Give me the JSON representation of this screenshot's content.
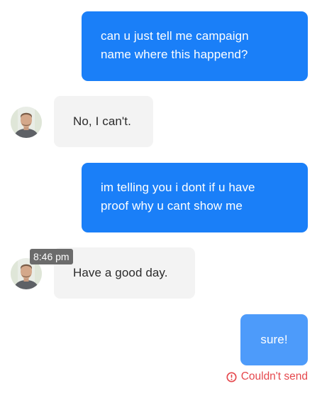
{
  "messages": [
    {
      "direction": "outgoing",
      "lines": [
        "can u just tell me campaign",
        "name where this happend?"
      ]
    },
    {
      "direction": "incoming",
      "text": "No, I can't."
    },
    {
      "direction": "outgoing",
      "lines": [
        "im telling you i dont if u have",
        "proof why u cant show me"
      ]
    },
    {
      "direction": "incoming",
      "text": "Have a good day.",
      "timestamp": "8:46 pm"
    },
    {
      "direction": "outgoing",
      "text": "sure!",
      "status": "Couldn't send"
    }
  ],
  "colors": {
    "outgoing": "#1a7ff8",
    "outgoing_pending": "#4d9bfa",
    "incoming": "#f3f3f3",
    "error": "#e5484d",
    "timestamp_badge": "#6b6b6b"
  },
  "icons": {
    "avatar": "agent-avatar",
    "error": "alert-circle-icon"
  }
}
